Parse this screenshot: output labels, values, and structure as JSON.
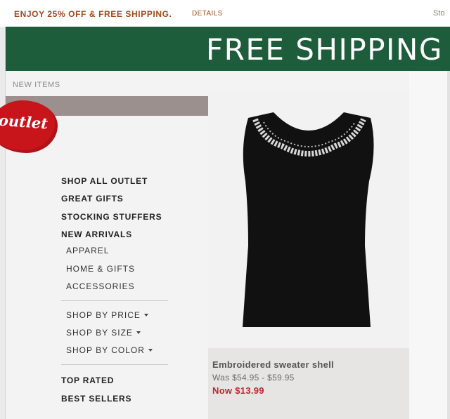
{
  "topbar": {
    "promo": "ENJOY 25% OFF & FREE SHIPPING.",
    "details_link": "DETAILS",
    "store_link": "Sto"
  },
  "banner": {
    "text": "FREE SHIPPING"
  },
  "breadcrumb": "NEW ITEMS",
  "badge": {
    "text": "outlet"
  },
  "nav": {
    "shop_all": "SHOP ALL OUTLET",
    "great_gifts": "GREAT GIFTS",
    "stocking_stuffers": "STOCKING STUFFERS",
    "new_arrivals": "NEW ARRIVALS",
    "apparel": "APPAREL",
    "home_gifts": "HOME & GIFTS",
    "accessories": "ACCESSORIES",
    "shop_by_price": "SHOP BY PRICE",
    "shop_by_size": "SHOP BY SIZE",
    "shop_by_color": "SHOP BY COLOR",
    "top_rated": "TOP RATED",
    "best_sellers": "BEST SELLERS"
  },
  "product": {
    "name": "Embroidered sweater shell",
    "was_price": "Was $54.95 - $59.95",
    "now_price": "Now $13.99"
  },
  "colors": {
    "promo_text": "#a04a1c",
    "banner_bg": "#1e5d3b",
    "badge_red": "#c8151c",
    "sale_red": "#c0262d"
  }
}
